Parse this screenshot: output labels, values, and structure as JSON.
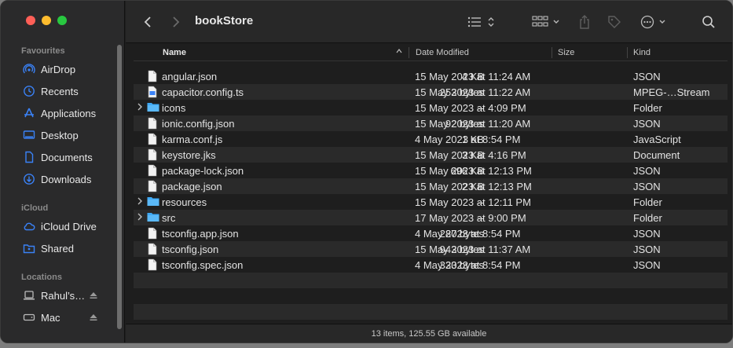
{
  "window": {
    "title": "bookStore"
  },
  "sidebar": {
    "sections": [
      {
        "label": "Favourites",
        "items": [
          {
            "label": "AirDrop",
            "icon": "airdrop-icon"
          },
          {
            "label": "Recents",
            "icon": "clock-icon"
          },
          {
            "label": "Applications",
            "icon": "applications-icon"
          },
          {
            "label": "Desktop",
            "icon": "desktop-icon"
          },
          {
            "label": "Documents",
            "icon": "document-icon"
          },
          {
            "label": "Downloads",
            "icon": "download-icon"
          }
        ]
      },
      {
        "label": "iCloud",
        "items": [
          {
            "label": "iCloud Drive",
            "icon": "cloud-icon"
          },
          {
            "label": "Shared",
            "icon": "shared-folder-icon"
          }
        ]
      },
      {
        "label": "Locations",
        "items": [
          {
            "label": "Rahul’s…",
            "icon": "laptop-icon"
          },
          {
            "label": "Mac",
            "icon": "disk-icon"
          }
        ]
      }
    ]
  },
  "columns": {
    "name": "Name",
    "date": "Date Modified",
    "size": "Size",
    "kind": "Kind"
  },
  "files": [
    {
      "name": "angular.json",
      "date": "15 May 2023 at 11:24 AM",
      "size": "4 KB",
      "kind": "JSON",
      "type": "file"
    },
    {
      "name": "capacitor.config.ts",
      "date": "15 May 2023 at 11:22 AM",
      "size": "253 bytes",
      "kind": "MPEG-…Stream",
      "type": "ts"
    },
    {
      "name": "icons",
      "date": "15 May 2023 at 4:09 PM",
      "size": "--",
      "kind": "Folder",
      "type": "folder"
    },
    {
      "name": "ionic.config.json",
      "date": "15 May 2023 at 11:20 AM",
      "size": "92 bytes",
      "kind": "JSON",
      "type": "file"
    },
    {
      "name": "karma.conf.js",
      "date": "4 May 2023 at 8:54 PM",
      "size": "1 KB",
      "kind": "JavaScript",
      "type": "file"
    },
    {
      "name": "keystore.jks",
      "date": "15 May 2023 at 4:16 PM",
      "size": "3 KB",
      "kind": "Document",
      "type": "file"
    },
    {
      "name": "package-lock.json",
      "date": "15 May 2023 at 12:13 PM",
      "size": "696 KB",
      "kind": "JSON",
      "type": "file"
    },
    {
      "name": "package.json",
      "date": "15 May 2023 at 12:13 PM",
      "size": "2 KB",
      "kind": "JSON",
      "type": "file"
    },
    {
      "name": "resources",
      "date": "15 May 2023 at 12:11 PM",
      "size": "--",
      "kind": "Folder",
      "type": "folder"
    },
    {
      "name": "src",
      "date": "17 May 2023 at 9:00 PM",
      "size": "--",
      "kind": "Folder",
      "type": "folder"
    },
    {
      "name": "tsconfig.app.json",
      "date": "4 May 2023 at 8:54 PM",
      "size": "287 bytes",
      "kind": "JSON",
      "type": "file"
    },
    {
      "name": "tsconfig.json",
      "date": "15 May 2023 at 11:37 AM",
      "size": "943 bytes",
      "kind": "JSON",
      "type": "file"
    },
    {
      "name": "tsconfig.spec.json",
      "date": "4 May 2023 at 8:54 PM",
      "size": "333 bytes",
      "kind": "JSON",
      "type": "file"
    }
  ],
  "status": "13 items, 125.55 GB available",
  "colors": {
    "folder": "#3fa9f5",
    "accent": "#3a82f7"
  }
}
